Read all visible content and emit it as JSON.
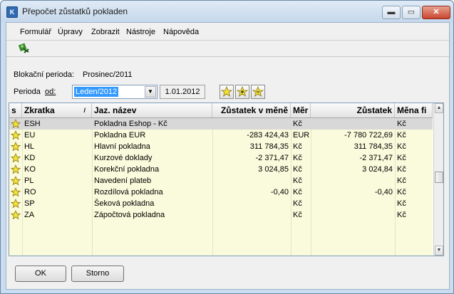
{
  "window": {
    "title": "Přepočet zůstatků pokladen",
    "min": "▬",
    "max": "▭",
    "close": "✕"
  },
  "menu": [
    "Formulář",
    "Úpravy",
    "Zobrazit",
    "Nástroje",
    "Nápověda"
  ],
  "toolbar": {
    "icon": "recalculate-icon"
  },
  "form": {
    "block_label": "Blokační perioda:",
    "block_value": "Prosinec/2011",
    "period_label": "Perioda",
    "from_label": "od:",
    "period_value": "Leden/2012",
    "date_value": "1.01.2012"
  },
  "grid": {
    "headers": [
      "s",
      "Zkratka",
      "Jaz. název",
      "Zůstatek v měně",
      "Měr",
      "Zůstatek",
      "Měna fi"
    ],
    "rows": [
      {
        "code": "ESH",
        "name": "Pokladna Eshop - Kč",
        "bal_cur": "",
        "cur": "Kč",
        "bal": "",
        "fcur": "Kč"
      },
      {
        "code": "EU",
        "name": "Pokladna EUR",
        "bal_cur": "-283 424,43",
        "cur": "EUR",
        "bal": "-7 780 722,69",
        "fcur": "Kč"
      },
      {
        "code": "HL",
        "name": "Hlavní pokladna",
        "bal_cur": "311 784,35",
        "cur": "Kč",
        "bal": "311 784,35",
        "fcur": "Kč"
      },
      {
        "code": "KD",
        "name": "Kurzové doklady",
        "bal_cur": "-2 371,47",
        "cur": "Kč",
        "bal": "-2 371,47",
        "fcur": "Kč"
      },
      {
        "code": "KO",
        "name": "Korekční pokladna",
        "bal_cur": "3 024,85",
        "cur": "Kč",
        "bal": "3 024,84",
        "fcur": "Kč"
      },
      {
        "code": "PL",
        "name": "Navedení plateb",
        "bal_cur": "",
        "cur": "Kč",
        "bal": "",
        "fcur": "Kč"
      },
      {
        "code": "RO",
        "name": "Rozdílová pokladna",
        "bal_cur": "-0,40",
        "cur": "Kč",
        "bal": "-0,40",
        "fcur": "Kč"
      },
      {
        "code": "SP",
        "name": "Šeková pokladna",
        "bal_cur": "",
        "cur": "Kč",
        "bal": "",
        "fcur": "Kč"
      },
      {
        "code": "ZA",
        "name": "Zápočtová pokladna",
        "bal_cur": "",
        "cur": "Kč",
        "bal": "",
        "fcur": "Kč"
      }
    ]
  },
  "buttons": {
    "ok": "OK",
    "cancel": "Storno"
  },
  "colors": {
    "accent": "#3399ff",
    "row_bg": "#fafadc",
    "selected_row": "#d8d8d8",
    "star": "#f5e23a"
  }
}
